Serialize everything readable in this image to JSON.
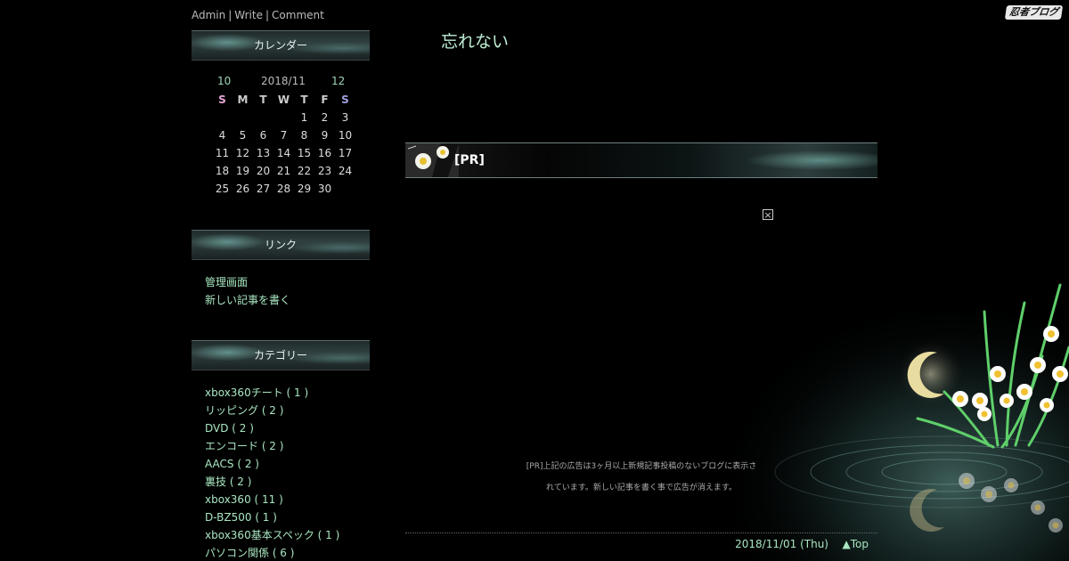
{
  "logo": {
    "text": "忍者ブログ"
  },
  "admin_bar": {
    "admin": "Admin",
    "write": "Write",
    "comment": "Comment",
    "separator": "|"
  },
  "calendar": {
    "title": "カレンダー",
    "prev": "10",
    "month": "2018/11",
    "next": "12",
    "weekdays": [
      "S",
      "M",
      "T",
      "W",
      "T",
      "F",
      "S"
    ],
    "weeks": [
      [
        "",
        "",
        "",
        "",
        "1",
        "2",
        "3"
      ],
      [
        "4",
        "5",
        "6",
        "7",
        "8",
        "9",
        "10"
      ],
      [
        "11",
        "12",
        "13",
        "14",
        "15",
        "16",
        "17"
      ],
      [
        "18",
        "19",
        "20",
        "21",
        "22",
        "23",
        "24"
      ],
      [
        "25",
        "26",
        "27",
        "28",
        "29",
        "30",
        ""
      ]
    ]
  },
  "links": {
    "title": "リンク",
    "items": [
      "管理画面",
      "新しい記事を書く"
    ]
  },
  "categories": {
    "title": "カテゴリー",
    "items": [
      "xbox360チート ( 1 )",
      "リッピング ( 2 )",
      "DVD ( 2 )",
      "エンコード ( 2 )",
      "AACS ( 2 )",
      "裏技 ( 2 )",
      "xbox360 ( 11 )",
      "D-BZ500 ( 1 )",
      "xbox360基本スペック ( 1 )",
      "パソコン関係 ( 6 )"
    ]
  },
  "main": {
    "blog_title": "忘れない",
    "pr_label": "[PR]",
    "close_glyph": "×",
    "pr_note_line1": "[PR]上記の広告は3ヶ月以上新規記事投稿のないブログに表示さ",
    "pr_note_line2": "れています。新しい記事を書く事で広告が消えます。",
    "entry_date": "2018/11/01 (Thu)",
    "top_link": "▲Top"
  },
  "colors": {
    "background": "#000000",
    "link": "#a8e6c0",
    "title": "#bff0d6",
    "sunday": "#e6a6d6",
    "saturday": "#9fa0e0"
  }
}
